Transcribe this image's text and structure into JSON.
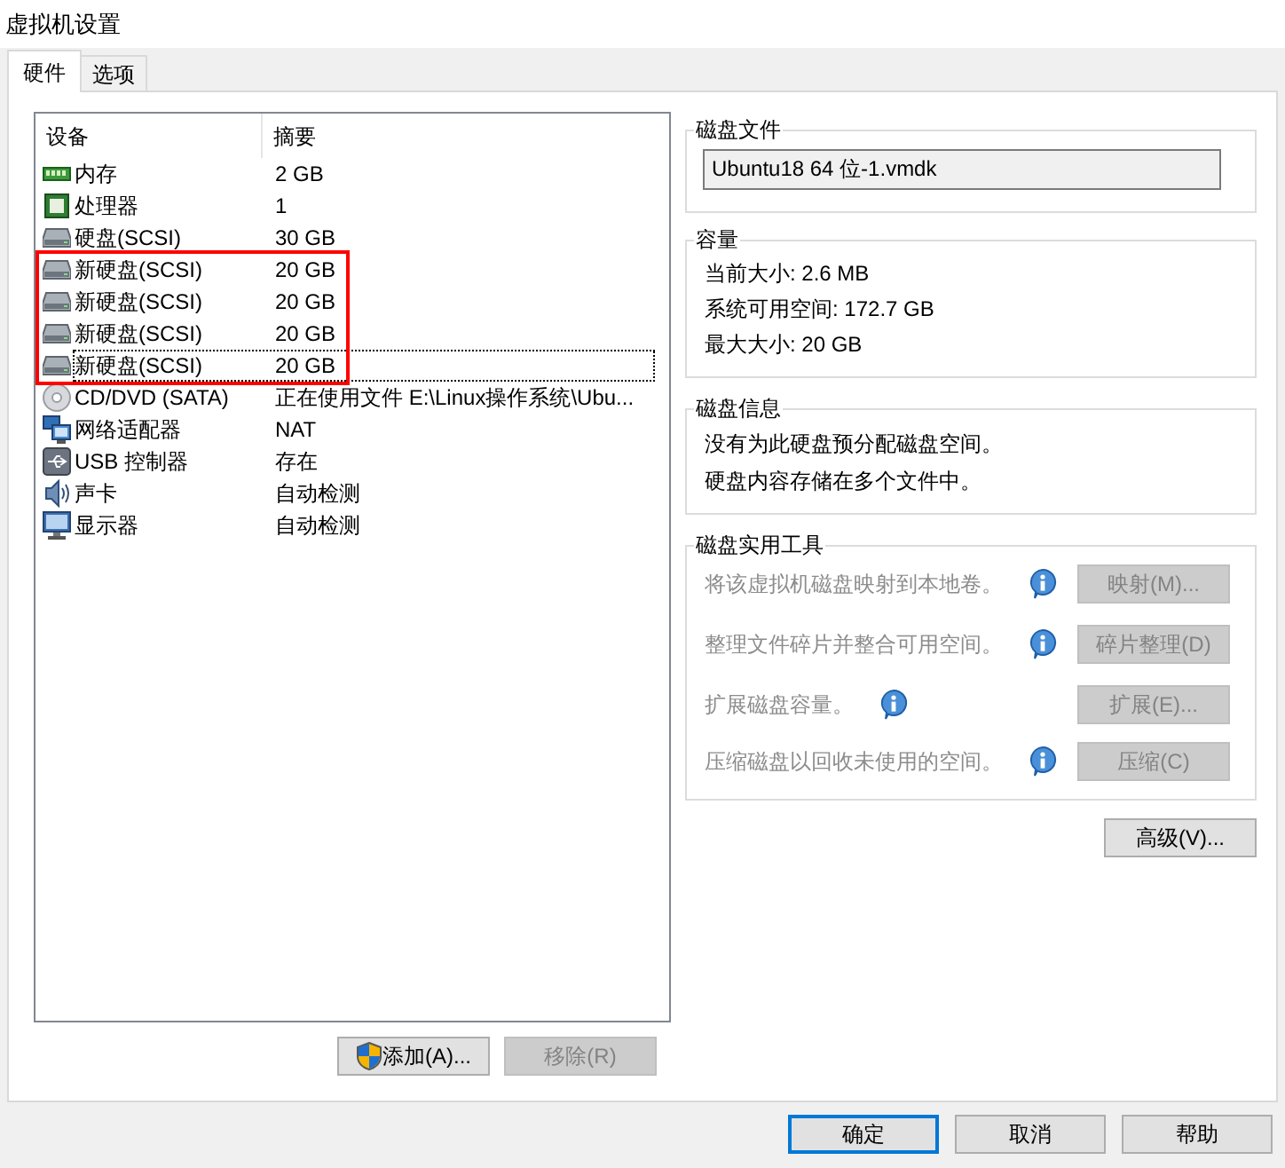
{
  "window": {
    "title": "虚拟机设置"
  },
  "tabs": [
    {
      "label": "硬件",
      "selected": true
    },
    {
      "label": "选项",
      "selected": false
    }
  ],
  "device_list": {
    "columns": [
      "设备",
      "摘要"
    ],
    "rows": [
      {
        "kind": "memory",
        "device": "内存",
        "summary": "2 GB",
        "selected": false,
        "highlighted": false
      },
      {
        "kind": "cpu",
        "device": "处理器",
        "summary": "1",
        "selected": false,
        "highlighted": false
      },
      {
        "kind": "disk",
        "device": "硬盘(SCSI)",
        "summary": "30 GB",
        "selected": false,
        "highlighted": false
      },
      {
        "kind": "disk",
        "device": "新硬盘(SCSI)",
        "summary": "20 GB",
        "selected": false,
        "highlighted": true
      },
      {
        "kind": "disk",
        "device": "新硬盘(SCSI)",
        "summary": "20 GB",
        "selected": false,
        "highlighted": true
      },
      {
        "kind": "disk",
        "device": "新硬盘(SCSI)",
        "summary": "20 GB",
        "selected": false,
        "highlighted": true
      },
      {
        "kind": "disk",
        "device": "新硬盘(SCSI)",
        "summary": "20 GB",
        "selected": true,
        "highlighted": true
      },
      {
        "kind": "cdrom",
        "device": "CD/DVD (SATA)",
        "summary": "正在使用文件 E:\\Linux操作系统\\Ubu...",
        "selected": false,
        "highlighted": false
      },
      {
        "kind": "network",
        "device": "网络适配器",
        "summary": "NAT",
        "selected": false,
        "highlighted": false
      },
      {
        "kind": "usb",
        "device": "USB 控制器",
        "summary": "存在",
        "selected": false,
        "highlighted": false
      },
      {
        "kind": "sound",
        "device": "声卡",
        "summary": "自动检测",
        "selected": false,
        "highlighted": false
      },
      {
        "kind": "display",
        "device": "显示器",
        "summary": "自动检测",
        "selected": false,
        "highlighted": false
      }
    ]
  },
  "list_buttons": [
    {
      "kind": "shield",
      "label": "添加(A)...",
      "disabled": false
    },
    {
      "kind": "plain",
      "label": "移除(R)",
      "disabled": true
    }
  ],
  "disk_file": {
    "title": "磁盘文件",
    "value": "Ubuntu18 64 位-1.vmdk"
  },
  "capacity": {
    "title": "容量",
    "lines": [
      "当前大小: 2.6 MB",
      "系统可用空间: 172.7 GB",
      "最大大小: 20 GB"
    ]
  },
  "disk_info": {
    "title": "磁盘信息",
    "lines": [
      "没有为此硬盘预分配磁盘空间。",
      "硬盘内容存储在多个文件中。"
    ]
  },
  "utilities": {
    "title": "磁盘实用工具",
    "rows": [
      {
        "text": "将该虚拟机磁盘映射到本地卷。",
        "button": "映射(M)...",
        "disabled": true
      },
      {
        "text": "整理文件碎片并整合可用空间。",
        "button": "碎片整理(D)",
        "disabled": true
      },
      {
        "text": "扩展磁盘容量。",
        "button": "扩展(E)...",
        "disabled": true
      },
      {
        "text": "压缩磁盘以回收未使用的空间。",
        "button": "压缩(C)",
        "disabled": true
      }
    ]
  },
  "advanced_button": {
    "label": "高级(V)...",
    "disabled": false
  },
  "dialog_buttons": [
    {
      "label": "确定",
      "default": true
    },
    {
      "label": "取消",
      "default": false
    },
    {
      "label": "帮助",
      "default": false
    }
  ]
}
